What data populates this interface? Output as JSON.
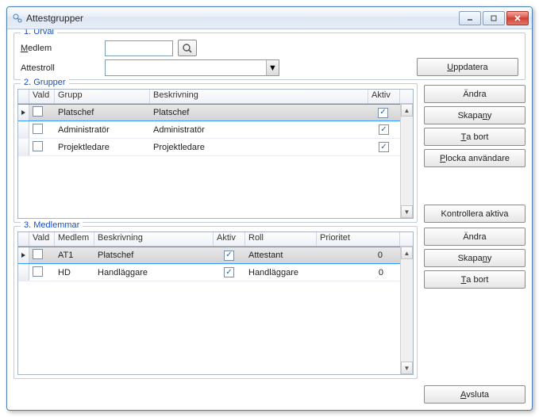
{
  "window": {
    "title": "Attestgrupper"
  },
  "urval": {
    "legend": "1. Urval",
    "medlem_label_pre": "M",
    "medlem_label_post": "edlem",
    "attestroll_label": "Attestroll",
    "medlem_value": "",
    "attestroll_value": "",
    "uppdatera_pre": "U",
    "uppdatera_post": "ppdatera"
  },
  "grupper": {
    "legend": "2. Grupper",
    "headers": {
      "vald": "Vald",
      "grupp": "Grupp",
      "beskrivning": "Beskrivning",
      "aktiv": "Aktiv"
    },
    "rows": [
      {
        "vald": false,
        "grupp": "Platschef",
        "beskrivning": "Platschef",
        "aktiv": true,
        "selected": true
      },
      {
        "vald": false,
        "grupp": "Administratör",
        "beskrivning": "Administratör",
        "aktiv": true,
        "selected": false
      },
      {
        "vald": false,
        "grupp": "Projektledare",
        "beskrivning": "Projektledare",
        "aktiv": true,
        "selected": false
      }
    ],
    "buttons": {
      "andra": "Ändra",
      "skapany_pre": "Skapa ",
      "skapany_u": "n",
      "skapany_post": "y",
      "tabort_pre": "T",
      "tabort_post": "a bort",
      "plocka_pre": "P",
      "plocka_post": "locka användare",
      "kontrollera": "Kontrollera aktiva"
    }
  },
  "medlemmar": {
    "legend": "3. Medlemmar",
    "headers": {
      "vald": "Vald",
      "medlem": "Medlem",
      "beskrivning": "Beskrivning",
      "aktiv": "Aktiv",
      "roll": "Roll",
      "prioritet": "Prioritet"
    },
    "rows": [
      {
        "vald": false,
        "medlem": "AT1",
        "beskrivning": "Platschef",
        "aktiv": true,
        "roll": "Attestant",
        "prioritet": "0",
        "selected": true
      },
      {
        "vald": false,
        "medlem": "HD",
        "beskrivning": "Handläggare",
        "aktiv": true,
        "roll": "Handläggare",
        "prioritet": "0",
        "selected": false
      }
    ],
    "buttons": {
      "andra": "Ändra",
      "skapany_pre": "Skapa ",
      "skapany_u": "n",
      "skapany_post": "y",
      "tabort_pre": "T",
      "tabort_post": "a bort"
    }
  },
  "footer": {
    "avsluta_pre": "A",
    "avsluta_post": "vsluta"
  }
}
